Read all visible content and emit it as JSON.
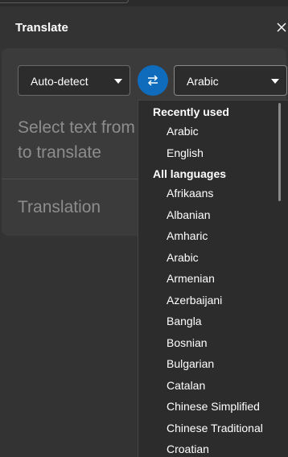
{
  "panel": {
    "title": "Translate",
    "close_icon": "close-icon"
  },
  "source_language": {
    "selected": "Auto-detect"
  },
  "target_language": {
    "selected": "Arabic"
  },
  "swap_icon": "swap-arrows-icon",
  "source_text": {
    "placeholder_line1": "Select text from",
    "placeholder_line2": "to translate"
  },
  "translation": {
    "placeholder": "Translation"
  },
  "dropdown": {
    "recent_header": "Recently used",
    "recent": [
      "Arabic",
      "English"
    ],
    "all_header": "All languages",
    "languages": [
      "Afrikaans",
      "Albanian",
      "Amharic",
      "Arabic",
      "Armenian",
      "Azerbaijani",
      "Bangla",
      "Bosnian",
      "Bulgarian",
      "Catalan",
      "Chinese Simplified",
      "Chinese Traditional",
      "Croatian"
    ]
  },
  "colors": {
    "accent": "#0f6cbd",
    "background": "#2b2b2b",
    "card": "#3b3b3b",
    "placeholder_text": "#8d8d8d"
  }
}
